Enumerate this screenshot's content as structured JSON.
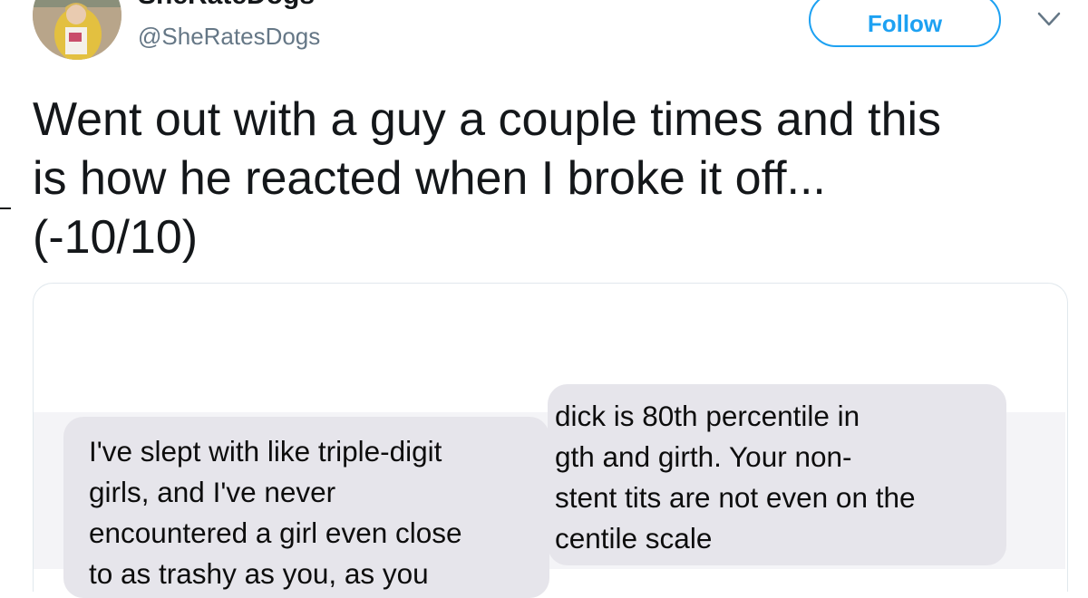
{
  "user": {
    "display_name": "SheRateDogs",
    "handle": "@SheRatesDogs",
    "avatar_icon": "profile-photo"
  },
  "actions": {
    "follow_label": "Follow",
    "more_icon": "chevron-down-icon"
  },
  "tweet": {
    "text": "Went out with a guy a couple times and this\nis how he reacted when I broke it off...\n(-10/10)"
  },
  "media": {
    "left_bubble": {
      "lines": [
        "I've slept with like triple-digit",
        "girls, and I've never",
        "encountered a girl even close",
        "to as trashy as you, as you"
      ]
    },
    "right_bubble": {
      "lines": [
        "dick is 80th percentile in",
        "gth and girth. Your non-",
        "stent tits are not even on the",
        "centile scale"
      ]
    }
  },
  "colors": {
    "accent": "#1da1f2",
    "handle_gray": "#657786",
    "text": "#14171a",
    "bubble_gray": "#e6e5eb"
  }
}
